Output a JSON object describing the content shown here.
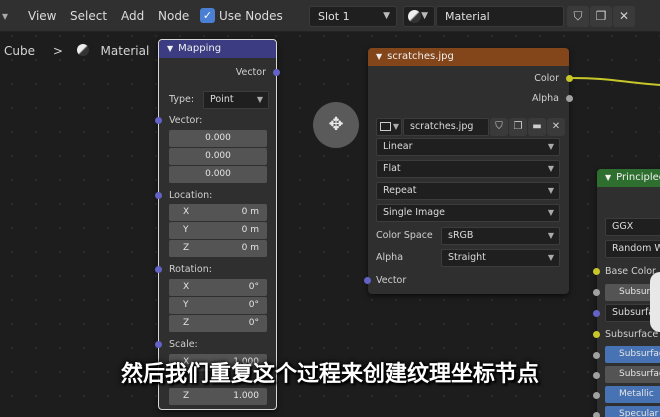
{
  "header": {
    "menu": [
      "View",
      "Select",
      "Add",
      "Node"
    ],
    "use_nodes_label": "Use Nodes",
    "slot": "Slot 1",
    "material_name": "Material"
  },
  "breadcrumb": {
    "object": "Cube",
    "material": "Material"
  },
  "mapping_node": {
    "title": "Mapping",
    "output_vector": "Vector",
    "type_label": "Type:",
    "type_value": "Point",
    "vector_label": "Vector:",
    "vector_values": [
      "0.000",
      "0.000",
      "0.000"
    ],
    "location_label": "Location:",
    "location": [
      {
        "axis": "X",
        "value": "0 m"
      },
      {
        "axis": "Y",
        "value": "0 m"
      },
      {
        "axis": "Z",
        "value": "0 m"
      }
    ],
    "rotation_label": "Rotation:",
    "rotation": [
      {
        "axis": "X",
        "value": "0°"
      },
      {
        "axis": "Y",
        "value": "0°"
      },
      {
        "axis": "Z",
        "value": "0°"
      }
    ],
    "scale_label": "Scale:",
    "scale": [
      {
        "axis": "X",
        "value": "1.000"
      },
      {
        "axis": "Z",
        "value": "1.000"
      }
    ]
  },
  "image_node": {
    "title": "scratches.jpg",
    "out_color": "Color",
    "out_alpha": "Alpha",
    "image_name": "scratches.jpg",
    "interpolation": "Linear",
    "projection": "Flat",
    "extension": "Repeat",
    "source": "Single Image",
    "color_space_label": "Color Space",
    "color_space": "sRGB",
    "alpha_label": "Alpha",
    "alpha_mode": "Straight",
    "in_vector": "Vector"
  },
  "bsdf_node": {
    "title": "Principled",
    "distribution": "GGX",
    "subsurface_method": "Random W",
    "base_color": "Base Color",
    "btn1": "Subsurf",
    "btn2": "Subsurface",
    "subsurface_color": "Subsurface C",
    "btn3": "Subsurfac",
    "btn4": "Subsurfac",
    "metallic": "Metallic",
    "specular": "Specular"
  },
  "subtitle": "然后我们重复这个过程来创建纹理坐标节点",
  "colors": {
    "mapping_header": "#3c3c83",
    "image_header": "#83461b",
    "bsdf_header": "#2e6e2e",
    "vector_socket": "#6363c7",
    "color_socket": "#c7c729"
  }
}
